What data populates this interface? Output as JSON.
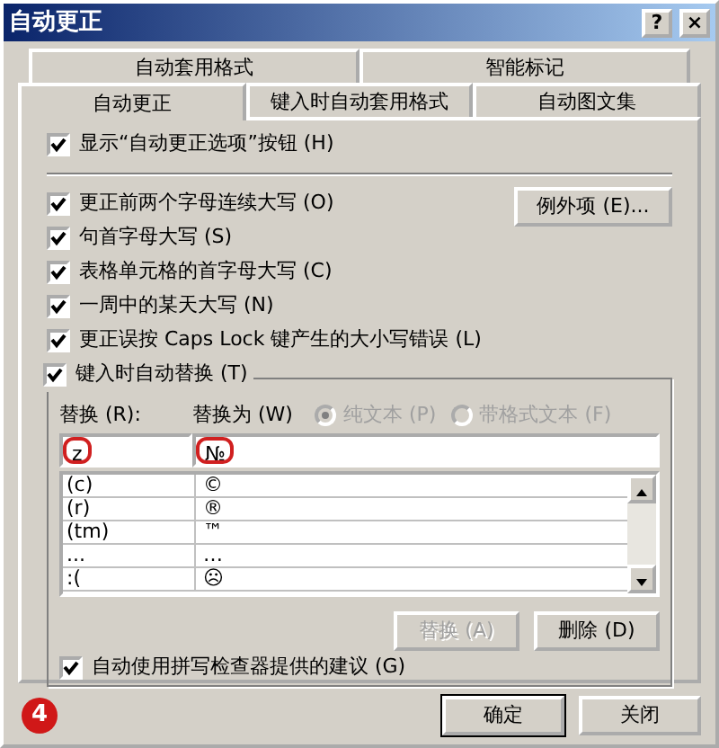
{
  "window": {
    "title": "自动更正",
    "title_buttons": [
      "?",
      "×"
    ]
  },
  "tab_rows": [
    [
      {
        "label": "自动套用格式",
        "selected": false
      },
      {
        "label": "智能标记",
        "selected": false
      }
    ],
    [
      {
        "label": "自动更正",
        "selected": true
      },
      {
        "label": "键入时自动套用格式",
        "selected": false
      },
      {
        "label": "自动图文集",
        "selected": false
      }
    ]
  ],
  "show_options_button": {
    "label": "显示“自动更正选项”按钮 (H)",
    "checked": true
  },
  "options": [
    {
      "label": "更正前两个字母连续大写 (O)",
      "checked": true
    },
    {
      "label": "句首字母大写 (S)",
      "checked": true
    },
    {
      "label": "表格单元格的首字母大写 (C)",
      "checked": true
    },
    {
      "label": "一周中的某天大写 (N)",
      "checked": true
    },
    {
      "label": "更正误按 Caps Lock 键产生的大小写错误 (L)",
      "checked": true
    }
  ],
  "exceptions_button": "例外项 (E)...",
  "replace_group": {
    "label": "键入时自动替换 (T)",
    "checked": true,
    "replace_label": "替换 (R):",
    "with_label": "替换为 (W)",
    "format_options": [
      {
        "label": "纯文本 (P)",
        "selected": true,
        "disabled": true
      },
      {
        "label": "带格式文本 (F)",
        "selected": false,
        "disabled": true
      }
    ],
    "replace_value": "z",
    "with_value": "№",
    "entries": [
      {
        "replace": "(c)",
        "with": "©"
      },
      {
        "replace": "(r)",
        "with": "®"
      },
      {
        "replace": "(tm)",
        "with": "™"
      },
      {
        "replace": "...",
        "with": "…"
      },
      {
        "replace": ":(",
        "with": "☹"
      }
    ],
    "buttons": [
      {
        "label": "替换 (A)",
        "disabled": true
      },
      {
        "label": "删除 (D)",
        "disabled": false
      }
    ],
    "spell_suggestions": {
      "label": "自动使用拼写检查器提供的建议 (G)",
      "checked": true
    }
  },
  "footer_buttons": [
    "确定",
    "关闭"
  ],
  "step_badge": "4"
}
